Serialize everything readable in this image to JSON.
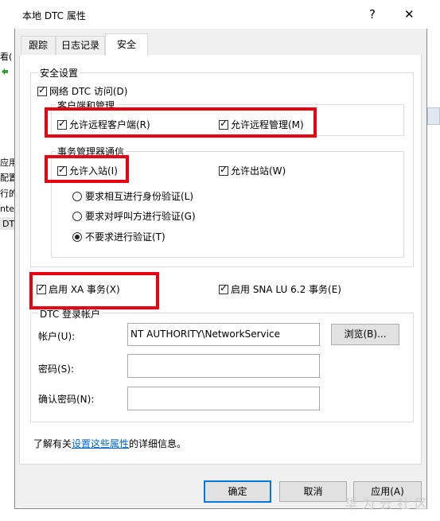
{
  "background_window": {
    "fragments": [
      "看(",
      "应用",
      "配置",
      "行的",
      "ntec",
      "DT"
    ]
  },
  "dialog": {
    "title": "本地 DTC 属性",
    "help_glyph": "?",
    "close_glyph": "✕",
    "tabs": [
      {
        "label": "跟踪"
      },
      {
        "label": "日志记录"
      },
      {
        "label": "安全"
      }
    ],
    "security_settings": {
      "group_label": "安全设置",
      "network_dtc_access": {
        "label": "网络 DTC 访问(D)",
        "checked": true
      },
      "client_admin": {
        "group_label": "客户端和管理",
        "allow_remote_clients": {
          "label": "允许远程客户端(R)",
          "checked": true
        },
        "allow_remote_admin": {
          "label": "允许远程管理(M)",
          "checked": true
        }
      },
      "tm_communication": {
        "group_label": "事务管理器通信",
        "allow_inbound": {
          "label": "允许入站(I)",
          "checked": true
        },
        "allow_outbound": {
          "label": "允许出站(W)",
          "checked": true
        },
        "auth_options": [
          {
            "label": "要求相互进行身份验证(L)",
            "selected": false
          },
          {
            "label": "要求对呼叫方进行验证(G)",
            "selected": false
          },
          {
            "label": "不要求进行验证(T)",
            "selected": true
          }
        ]
      }
    },
    "enable_xa": {
      "label": "启用 XA 事务(X)",
      "checked": true
    },
    "enable_sna": {
      "label": "启用 SNA LU 6.2 事务(E)",
      "checked": true
    },
    "logon_account": {
      "group_label": "DTC 登录帐户",
      "account_label": "帐户(U):",
      "account_value": "NT AUTHORITY\\NetworkService",
      "browse_label": "浏览(B)...",
      "password_label": "密码(S):",
      "password_value": "",
      "confirm_label": "确认密码(N):",
      "confirm_value": ""
    },
    "info_text": {
      "prefix": "了解有关",
      "link": "设置这些属性",
      "suffix": "的详细信息。"
    },
    "buttons": {
      "ok": "确定",
      "cancel": "取消",
      "apply": "应用(A)"
    },
    "check_glyph": "✓"
  },
  "watermark": "华为云社区",
  "colors": {
    "highlight": "#e60012",
    "link": "#0066cc",
    "primary_button_border": "#0078d7",
    "dialog_bg": "#f0f0f0"
  }
}
